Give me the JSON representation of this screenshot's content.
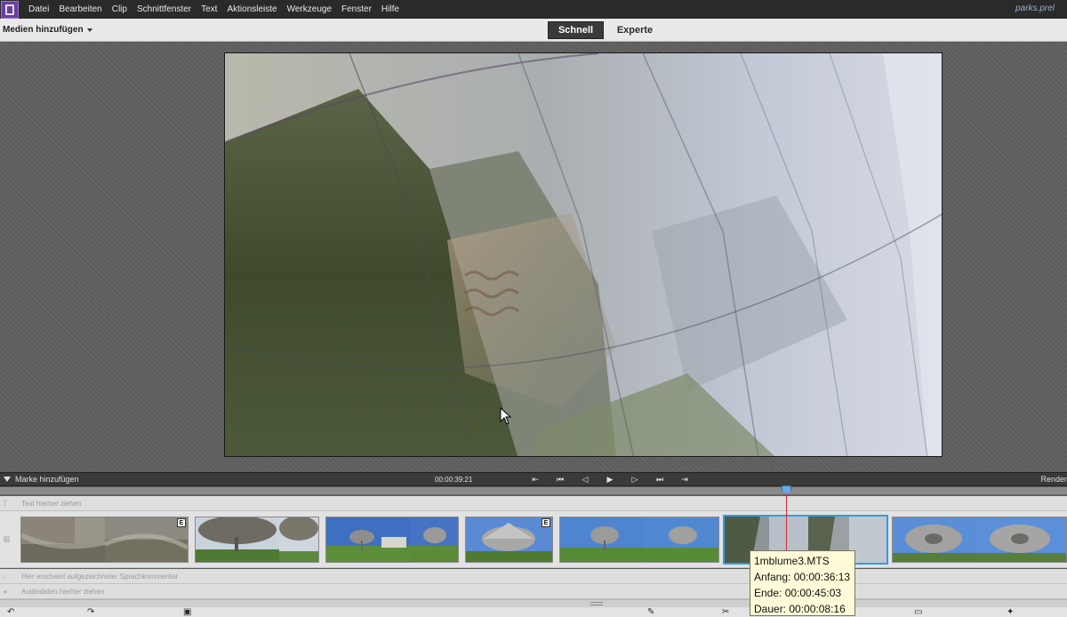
{
  "app": {
    "project_name": "parks.prel"
  },
  "menu": [
    "Datei",
    "Bearbeiten",
    "Clip",
    "Schnittfenster",
    "Text",
    "Aktionsleiste",
    "Werkzeuge",
    "Fenster",
    "Hilfe"
  ],
  "toolbar": {
    "add_media": "Medien hinzufügen",
    "mode_quick": "Schnell",
    "mode_expert": "Experte"
  },
  "transport": {
    "add_marker": "Marke hinzufügen",
    "timecode": "00:00:39:21",
    "render": "Render"
  },
  "tracks": {
    "text_placeholder": "Text hierher ziehen",
    "voice_placeholder": "Hier erscheint aufgezeichneter Sprachkommentar",
    "audio_placeholder": "Audiodaten hierher ziehen"
  },
  "tooltip": {
    "name": "1mblume3.MTS",
    "start": "Anfang: 00:00:36:13",
    "end": "Ende: 00:00:45:03",
    "duration": "Dauer: 00:00:08:16"
  },
  "clips": [
    {
      "scene": "water-wall",
      "fx": "E"
    },
    {
      "scene": "flower-underside",
      "fx": ""
    },
    {
      "scene": "flower-park",
      "fx": ""
    },
    {
      "scene": "flower-close",
      "fx": "E"
    },
    {
      "scene": "flower-field",
      "fx": ""
    },
    {
      "scene": "metal-petal",
      "fx": "",
      "selected": true
    },
    {
      "scene": "flower-sky",
      "fx": ""
    }
  ],
  "colors": {
    "accent": "#2f9ee6",
    "playhead": "#d23030"
  }
}
